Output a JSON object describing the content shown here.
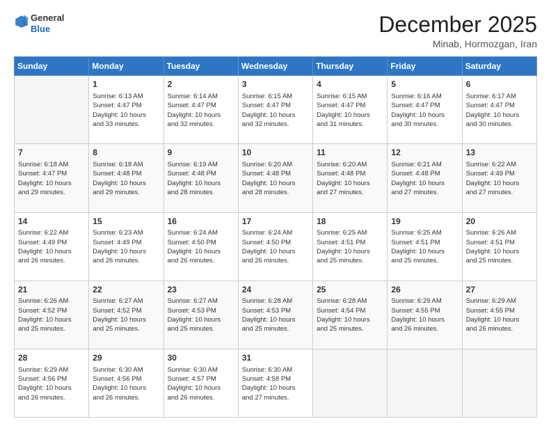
{
  "header": {
    "logo_line1": "General",
    "logo_line2": "Blue",
    "month": "December 2025",
    "location": "Minab, Hormozgan, Iran"
  },
  "weekdays": [
    "Sunday",
    "Monday",
    "Tuesday",
    "Wednesday",
    "Thursday",
    "Friday",
    "Saturday"
  ],
  "rows": [
    [
      {
        "day": "",
        "info": ""
      },
      {
        "day": "1",
        "info": "Sunrise: 6:13 AM\nSunset: 4:47 PM\nDaylight: 10 hours\nand 33 minutes."
      },
      {
        "day": "2",
        "info": "Sunrise: 6:14 AM\nSunset: 4:47 PM\nDaylight: 10 hours\nand 32 minutes."
      },
      {
        "day": "3",
        "info": "Sunrise: 6:15 AM\nSunset: 4:47 PM\nDaylight: 10 hours\nand 32 minutes."
      },
      {
        "day": "4",
        "info": "Sunrise: 6:15 AM\nSunset: 4:47 PM\nDaylight: 10 hours\nand 31 minutes."
      },
      {
        "day": "5",
        "info": "Sunrise: 6:16 AM\nSunset: 4:47 PM\nDaylight: 10 hours\nand 30 minutes."
      },
      {
        "day": "6",
        "info": "Sunrise: 6:17 AM\nSunset: 4:47 PM\nDaylight: 10 hours\nand 30 minutes."
      }
    ],
    [
      {
        "day": "7",
        "info": "Sunrise: 6:18 AM\nSunset: 4:47 PM\nDaylight: 10 hours\nand 29 minutes."
      },
      {
        "day": "8",
        "info": "Sunrise: 6:18 AM\nSunset: 4:48 PM\nDaylight: 10 hours\nand 29 minutes."
      },
      {
        "day": "9",
        "info": "Sunrise: 6:19 AM\nSunset: 4:48 PM\nDaylight: 10 hours\nand 28 minutes."
      },
      {
        "day": "10",
        "info": "Sunrise: 6:20 AM\nSunset: 4:48 PM\nDaylight: 10 hours\nand 28 minutes."
      },
      {
        "day": "11",
        "info": "Sunrise: 6:20 AM\nSunset: 4:48 PM\nDaylight: 10 hours\nand 27 minutes."
      },
      {
        "day": "12",
        "info": "Sunrise: 6:21 AM\nSunset: 4:48 PM\nDaylight: 10 hours\nand 27 minutes."
      },
      {
        "day": "13",
        "info": "Sunrise: 6:22 AM\nSunset: 4:49 PM\nDaylight: 10 hours\nand 27 minutes."
      }
    ],
    [
      {
        "day": "14",
        "info": "Sunrise: 6:22 AM\nSunset: 4:49 PM\nDaylight: 10 hours\nand 26 minutes."
      },
      {
        "day": "15",
        "info": "Sunrise: 6:23 AM\nSunset: 4:49 PM\nDaylight: 10 hours\nand 26 minutes."
      },
      {
        "day": "16",
        "info": "Sunrise: 6:24 AM\nSunset: 4:50 PM\nDaylight: 10 hours\nand 26 minutes."
      },
      {
        "day": "17",
        "info": "Sunrise: 6:24 AM\nSunset: 4:50 PM\nDaylight: 10 hours\nand 26 minutes."
      },
      {
        "day": "18",
        "info": "Sunrise: 6:25 AM\nSunset: 4:51 PM\nDaylight: 10 hours\nand 25 minutes."
      },
      {
        "day": "19",
        "info": "Sunrise: 6:25 AM\nSunset: 4:51 PM\nDaylight: 10 hours\nand 25 minutes."
      },
      {
        "day": "20",
        "info": "Sunrise: 6:26 AM\nSunset: 4:51 PM\nDaylight: 10 hours\nand 25 minutes."
      }
    ],
    [
      {
        "day": "21",
        "info": "Sunrise: 6:26 AM\nSunset: 4:52 PM\nDaylight: 10 hours\nand 25 minutes."
      },
      {
        "day": "22",
        "info": "Sunrise: 6:27 AM\nSunset: 4:52 PM\nDaylight: 10 hours\nand 25 minutes."
      },
      {
        "day": "23",
        "info": "Sunrise: 6:27 AM\nSunset: 4:53 PM\nDaylight: 10 hours\nand 25 minutes."
      },
      {
        "day": "24",
        "info": "Sunrise: 6:28 AM\nSunset: 4:53 PM\nDaylight: 10 hours\nand 25 minutes."
      },
      {
        "day": "25",
        "info": "Sunrise: 6:28 AM\nSunset: 4:54 PM\nDaylight: 10 hours\nand 25 minutes."
      },
      {
        "day": "26",
        "info": "Sunrise: 6:29 AM\nSunset: 4:55 PM\nDaylight: 10 hours\nand 26 minutes."
      },
      {
        "day": "27",
        "info": "Sunrise: 6:29 AM\nSunset: 4:55 PM\nDaylight: 10 hours\nand 26 minutes."
      }
    ],
    [
      {
        "day": "28",
        "info": "Sunrise: 6:29 AM\nSunset: 4:56 PM\nDaylight: 10 hours\nand 26 minutes."
      },
      {
        "day": "29",
        "info": "Sunrise: 6:30 AM\nSunset: 4:56 PM\nDaylight: 10 hours\nand 26 minutes."
      },
      {
        "day": "30",
        "info": "Sunrise: 6:30 AM\nSunset: 4:57 PM\nDaylight: 10 hours\nand 26 minutes."
      },
      {
        "day": "31",
        "info": "Sunrise: 6:30 AM\nSunset: 4:58 PM\nDaylight: 10 hours\nand 27 minutes."
      },
      {
        "day": "",
        "info": ""
      },
      {
        "day": "",
        "info": ""
      },
      {
        "day": "",
        "info": ""
      }
    ]
  ]
}
